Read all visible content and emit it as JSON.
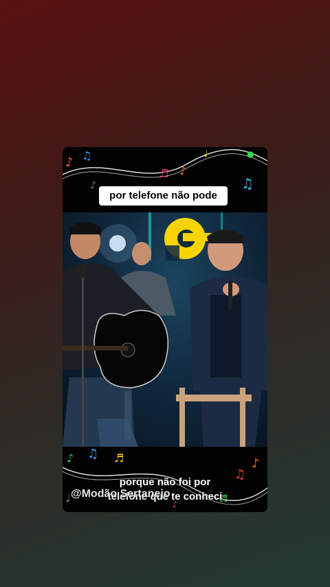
{
  "captions": {
    "top": "por telefone não pode",
    "bottom_line1": "porque não foi por",
    "bottom_line2": "telefone que te conheci"
  },
  "watermark": "@Modão Sertanejo",
  "colors": {
    "background_top": "#5a1212",
    "background_bottom": "#233a30",
    "logo_yellow": "#f5d400",
    "caption_bg": "#ffffff"
  },
  "icons": {
    "music_notes": "music-notes-decoration",
    "logo": "yellow-ring-logo"
  }
}
